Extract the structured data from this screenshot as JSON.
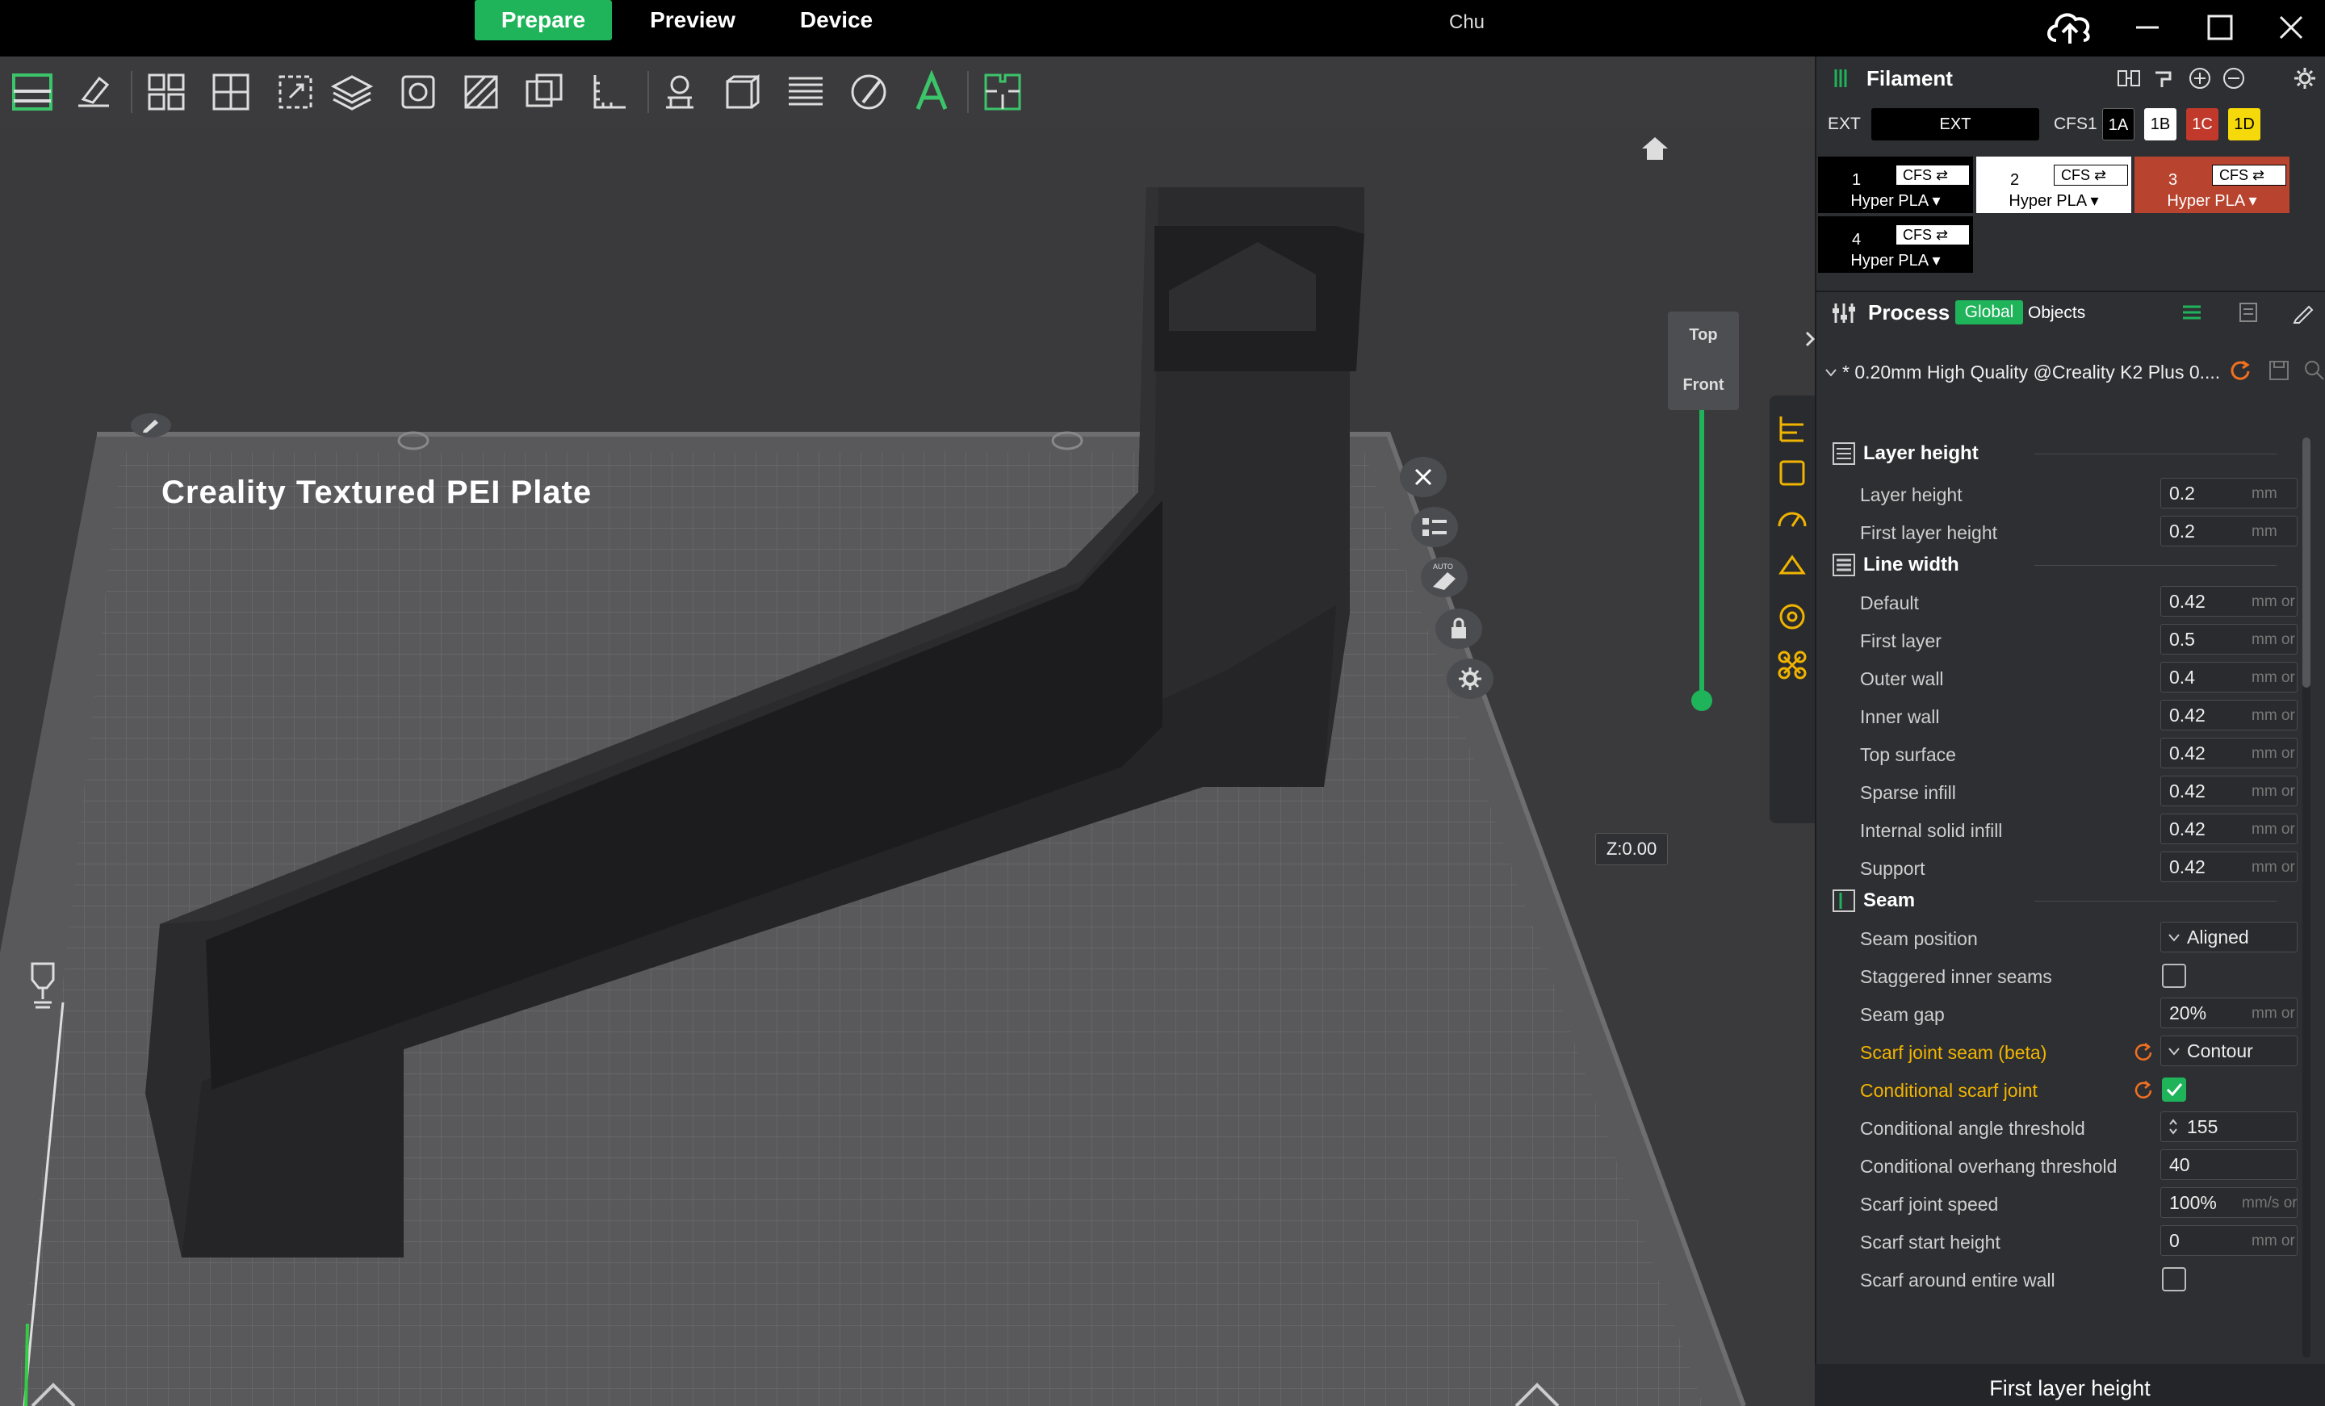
{
  "topbar": {
    "tabs": [
      {
        "label": "Prepare",
        "active": true
      },
      {
        "label": "Preview",
        "active": false
      },
      {
        "label": "Device",
        "active": false
      }
    ],
    "window_title": "Chu",
    "icons": [
      "cloud-upload-icon",
      "minimize-icon",
      "maximize-icon",
      "close-icon"
    ]
  },
  "toolbar": {
    "tools": [
      "layout-icon",
      "erase-icon",
      "arrange-icon",
      "orient-icon",
      "scale-icon",
      "layer-icon",
      "cube-icon",
      "cut-icon",
      "split-icon",
      "measure-icon",
      "support-paint-icon",
      "seam-paint-icon",
      "variable-layer-icon",
      "brush-icon",
      "text-icon",
      "assembly-icon"
    ]
  },
  "viewport": {
    "plate_label": "Creality Textured PEI Plate",
    "nav_cube": {
      "top": "Top",
      "front": "Front"
    },
    "z_label": "Z:0.00",
    "auto_label": "AUTO",
    "side_icons": [
      "close-icon",
      "list-icon",
      "auto-orient-icon",
      "lock-icon",
      "settings-icon"
    ]
  },
  "filament": {
    "title": "Filament",
    "ext_label": "EXT",
    "ext_value": "EXT",
    "cfs_label": "CFS1",
    "slots": [
      {
        "label": "1A",
        "color": "#000000"
      },
      {
        "label": "1B",
        "color": "#ffffff"
      },
      {
        "label": "1C",
        "color": "#c0392b"
      },
      {
        "label": "1D",
        "color": "#f5d90a"
      }
    ],
    "cards": [
      {
        "num": "1",
        "cfs": "CFS ⇄",
        "material": "Hyper PLA ▾",
        "color": "#000000"
      },
      {
        "num": "2",
        "cfs": "CFS ⇄",
        "material": "Hyper PLA ▾",
        "color": "#ffffff"
      },
      {
        "num": "3",
        "cfs": "CFS ⇄",
        "material": "Hyper PLA ▾",
        "color": "#b8432e"
      },
      {
        "num": "4",
        "cfs": "CFS ⇄",
        "material": "Hyper PLA ▾",
        "color": "#000000"
      }
    ]
  },
  "process": {
    "title": "Process",
    "global_label": "Global",
    "objects_label": "Objects",
    "preset": "* 0.20mm High Quality @Creality K2 Plus 0...."
  },
  "settings": {
    "layer_height_section": "Layer height",
    "layer_height": {
      "label": "Layer height",
      "value": "0.2",
      "unit": "mm"
    },
    "first_layer_height": {
      "label": "First layer height",
      "value": "0.2",
      "unit": "mm"
    },
    "line_width_section": "Line width",
    "lw_default": {
      "label": "Default",
      "value": "0.42",
      "unit": "mm or"
    },
    "lw_first_layer": {
      "label": "First layer",
      "value": "0.5",
      "unit": "mm or"
    },
    "lw_outer_wall": {
      "label": "Outer wall",
      "value": "0.4",
      "unit": "mm or"
    },
    "lw_inner_wall": {
      "label": "Inner wall",
      "value": "0.42",
      "unit": "mm or"
    },
    "lw_top_surface": {
      "label": "Top surface",
      "value": "0.42",
      "unit": "mm or"
    },
    "lw_sparse_infill": {
      "label": "Sparse infill",
      "value": "0.42",
      "unit": "mm or"
    },
    "lw_internal_solid": {
      "label": "Internal solid infill",
      "value": "0.42",
      "unit": "mm or"
    },
    "lw_support": {
      "label": "Support",
      "value": "0.42",
      "unit": "mm or"
    },
    "seam_section": "Seam",
    "seam_position": {
      "label": "Seam position",
      "value": "Aligned"
    },
    "staggered_inner_seams": {
      "label": "Staggered inner seams",
      "checked": false
    },
    "seam_gap": {
      "label": "Seam gap",
      "value": "20%",
      "unit": "mm or"
    },
    "scarf_joint_seam": {
      "label": "Scarf joint seam (beta)",
      "value": "Contour"
    },
    "conditional_scarf": {
      "label": "Conditional scarf joint",
      "checked": true
    },
    "cond_angle": {
      "label": "Conditional angle threshold",
      "value": "155"
    },
    "cond_overhang": {
      "label": "Conditional overhang threshold",
      "value": "40"
    },
    "scarf_speed": {
      "label": "Scarf joint speed",
      "value": "100%",
      "unit": "mm/s or"
    },
    "scarf_start_height": {
      "label": "Scarf start height",
      "value": "0",
      "unit": "mm or"
    },
    "scarf_entire_wall": {
      "label": "Scarf around entire wall",
      "checked": false
    }
  },
  "bottom_bar": {
    "label": "First layer height"
  },
  "colors": {
    "accent": "#1fb35a",
    "modified": "#f0b400",
    "panel_bg": "#2e2f33"
  }
}
